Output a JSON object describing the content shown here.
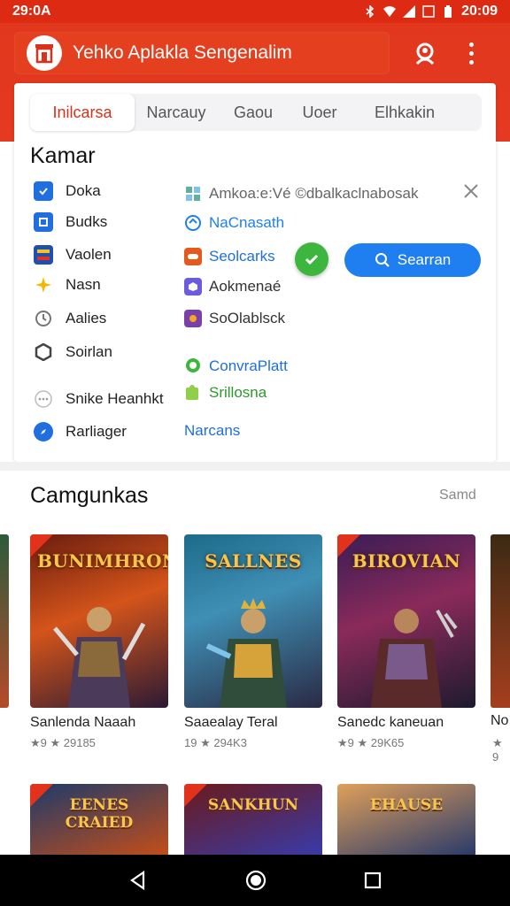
{
  "status_bar": {
    "time": "29:0A",
    "clock": "20:09"
  },
  "app_bar": {
    "title": "Yehko Aplakla Sengenalim"
  },
  "tabs": [
    "Inilcarsa",
    "Narcauy",
    "Gaou",
    "Uoer",
    "Elhkakin"
  ],
  "card": {
    "title": "Kamar",
    "left_items": [
      "Doka",
      "Budks",
      "Vaolen",
      "Nasn",
      "Aalies",
      "Soirlan",
      "Snike Heanhkt",
      "Rarliager"
    ],
    "right_items": [
      "Amkoa:e:Vé ©dbalkaclnabosak",
      "NaCnasath",
      "Seolcarks",
      "Aokmenaé",
      "SoOlablsck",
      "ConvraPlatt",
      "Srillosna",
      "Narcans"
    ],
    "search_button": "Searran"
  },
  "section2": {
    "title": "Camgunkas",
    "more": "Samd",
    "games": [
      {
        "art_title": "BUNIMHRON",
        "name": "Sanlenda Naaah",
        "meta": "★9 ★ 29185"
      },
      {
        "art_title": "SALLNES",
        "name": "Saaealay Teral",
        "meta": "19 ★ 294K3"
      },
      {
        "art_title": "BIROVIAN",
        "name": "Sanedc kaneuan",
        "meta": "★9 ★ 29K65"
      }
    ],
    "partial_name": "No",
    "partial_meta": "★ 9",
    "row2_titles": [
      "EENES CRAIED",
      "SANKHUN",
      "EHAUSE"
    ]
  },
  "colors": {
    "brand": "#dd2a12",
    "accent_blue": "#1f7ef0",
    "accent_green": "#3cb63c"
  }
}
